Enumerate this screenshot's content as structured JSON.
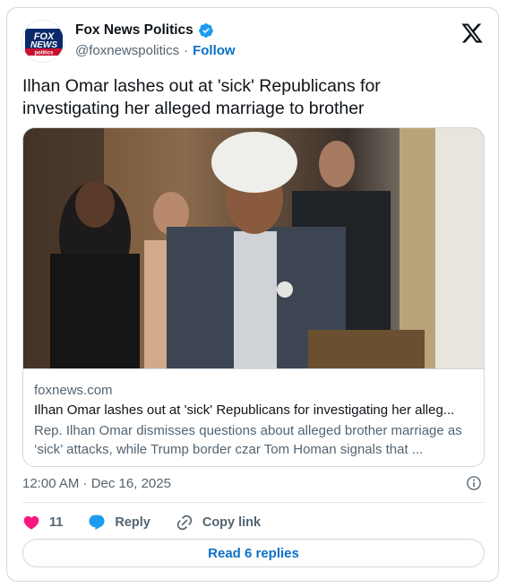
{
  "author": {
    "display_name": "Fox News Politics",
    "handle": "@foxnewspolitics",
    "separator": "·",
    "follow_label": "Follow",
    "avatar_logo": {
      "line1": "FOX",
      "line2": "NEWS",
      "line3": "politics"
    },
    "verified_color": "#1d9bf0"
  },
  "tweet": {
    "text": "Ilhan Omar lashes out at 'sick' Republicans for investigating her alleged marriage to brother"
  },
  "link_card": {
    "domain": "foxnews.com",
    "title": "Ilhan Omar lashes out at 'sick' Republicans for investigating her alleg...",
    "description": "Rep. Ilhan Omar dismisses questions about alleged brother marriage as ‘sick’ attacks, while Trump border czar Tom Homan signals that ..."
  },
  "meta": {
    "timestamp": "12:00 AM · Dec 16, 2025"
  },
  "actions": {
    "like_count": "11",
    "reply_label": "Reply",
    "copy_link_label": "Copy link",
    "like_color": "#f91880",
    "reply_color": "#1d9bf0"
  },
  "footer": {
    "read_replies_label": "Read 6 replies"
  },
  "icons": [
    "x-logo-icon",
    "verified-badge-icon",
    "info-icon",
    "heart-icon",
    "reply-bubble-icon",
    "link-icon"
  ]
}
